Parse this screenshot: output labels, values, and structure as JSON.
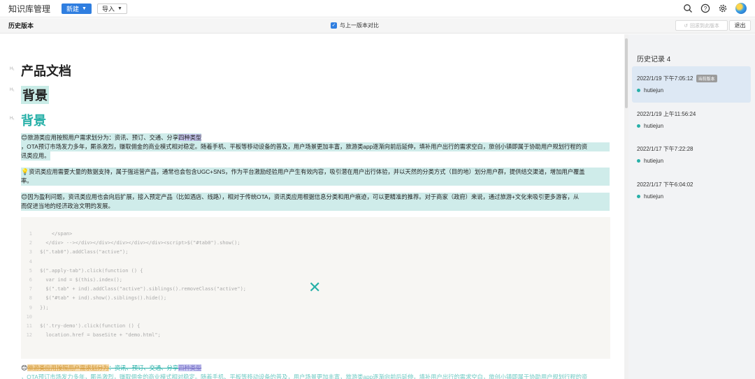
{
  "topnav": {
    "app_title": "知识库管理",
    "new_label": "新建",
    "import_label": "导入"
  },
  "version_bar": {
    "title": "历史版本",
    "compare_label": "与上一版本对比",
    "restore_label": "回滚到此版本",
    "exit_label": "退出"
  },
  "doc": {
    "heading_marks": [
      "H₁",
      "H₁",
      "H₁"
    ],
    "title": "产品文档",
    "heading2": "背景",
    "heading3": "背景",
    "para1_line1": "旅游类应用按照用户需求划分为：资讯、预订、交通、分享",
    "para1_line1_tail": "四种类型",
    "para1_line2": "，OTA预订市场发力多年，厮杀激烈，赚取佣金的商业模式相对稳定。随着手机、平板等移动设备的普及，用户场景更加丰富，旅游类app逐渐向前后延伸，填补用户出行的需求空白，旅创小镇即属于协助用户规划行程的资",
    "para1_line3": "讯类应用。",
    "para2_line1": "资讯类应用需要大量的数据支持，属于强运营产品，通常也会包含UGC+SNS，作为平台激励经验用户产生有效内容，吸引潜在用户出行体验，并以天然的分类方式（目的地）划分用户群，提供结交渠道，增加用户覆盖",
    "para2_line2": "率。",
    "para3_line1": "因为盈利问题，资讯类应用也会向后扩展，接入预定产品（比如酒店、线路），相对于传统OTA，资讯类应用根据信息分类和用户痕迹，可以更精准的推荐。对于商家（政府）来说，通过旅游+文化来吸引更多游客，从",
    "para3_line2": "而促进当地的经济政治文明的发展。",
    "code_lines": [
      {
        "num": "1",
        "text": "    </span>"
      },
      {
        "num": "2",
        "text": "  </div> --></div></div></div></div></div><script>$(\"#tab0\").show();"
      },
      {
        "num": "3",
        "text": "$(\".tab0\").addClass(\"active\");"
      },
      {
        "num": "4",
        "text": ""
      },
      {
        "num": "5",
        "text": "$(\".apply-tab\").click(function () {"
      },
      {
        "num": "6",
        "text": "  var ind = $(this).index();"
      },
      {
        "num": "7",
        "text": "  $(\".tab\" + ind).addClass(\"active\").siblings().removeClass(\"active\");"
      },
      {
        "num": "8",
        "text": "  $(\"#tab\" + ind).show().siblings().hide();"
      },
      {
        "num": "9",
        "text": "});"
      },
      {
        "num": "10",
        "text": ""
      },
      {
        "num": "11",
        "text": "$('.try-demo').click(function () {"
      },
      {
        "num": "12",
        "text": "  location.href = baseSite + \"demo.html\";"
      }
    ],
    "strike_a": "旅游类应用按照用户需求划分为",
    "strike_b": "：资讯、预订、交通、分享",
    "strike_c": "四种类型",
    "cut_line": "，OTA预订市场发力多年，厮杀激烈，赚取佣金的商业模式相对稳定。随着手机、平板等移动设备的普及，用户场景更加丰富，旅游类app逐渐向前后延伸，填补用户出行的需求空白，旅创小镇即属于协助用户规划行程的资"
  },
  "history": {
    "title": "历史记录 4",
    "items": [
      {
        "time": "2022/1/19 下午7:05:12",
        "badge": "当前版本",
        "user": "hutiejun"
      },
      {
        "time": "2022/1/19 上午11:56:24",
        "user": "hutiejun"
      },
      {
        "time": "2022/1/17 下午7:22:28",
        "user": "hutiejun"
      },
      {
        "time": "2022/1/17 下午6:04:02",
        "user": "hutiejun"
      }
    ]
  },
  "colors": {
    "accent": "#2f7ee0",
    "teal": "#27b0a8",
    "highlight_teal": "#cfecea",
    "highlight_purple": "#c9c8f1"
  }
}
